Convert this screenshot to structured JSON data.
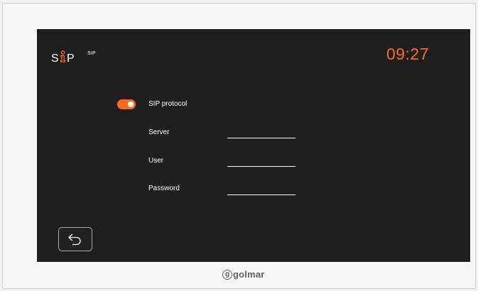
{
  "header": {
    "logo_text": "SiP",
    "title": "SIP",
    "time": "09:27"
  },
  "settings": {
    "sip_protocol": {
      "label": "SIP protocol",
      "enabled": true
    },
    "server": {
      "label": "Server",
      "value": ""
    },
    "user": {
      "label": "User",
      "value": ""
    },
    "password": {
      "label": "Password",
      "value": ""
    }
  },
  "footer": {
    "brand": "golmar",
    "back_icon": "back-arrow-icon"
  },
  "colors": {
    "accent": "#ff6a1a",
    "screen_bg": "#1f1f1f",
    "bezel": "#f7f7f8"
  }
}
